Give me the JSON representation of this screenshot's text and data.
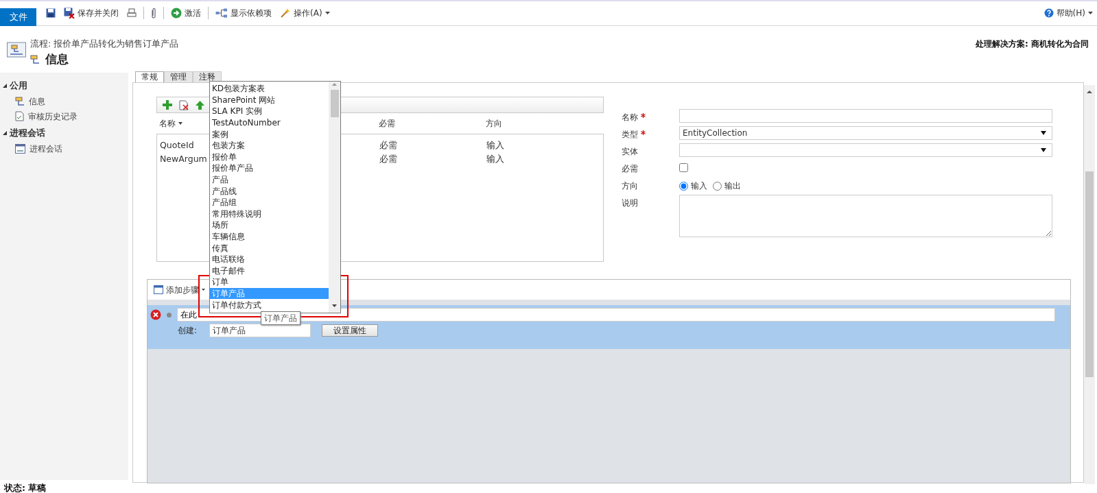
{
  "toolbar": {
    "file_tab": "文件",
    "items": [
      {
        "kind": "save"
      },
      {
        "kind": "save_close",
        "label": "保存并关闭"
      },
      {
        "kind": "print"
      },
      {
        "kind": "separator"
      },
      {
        "kind": "attach"
      },
      {
        "kind": "separator"
      },
      {
        "kind": "activate",
        "label": "激活"
      },
      {
        "kind": "separator"
      },
      {
        "kind": "dependencies",
        "label": "显示依赖项"
      },
      {
        "kind": "actions",
        "label": "操作(A)",
        "menu": true
      }
    ],
    "help": {
      "label": "帮助(H)",
      "menu": true
    }
  },
  "header": {
    "breadcrumb": "流程: 报价单产品转化为销售订单产品",
    "title": "信息",
    "solution": "处理解决方案: 商机转化为合同"
  },
  "sidebar": {
    "groups": [
      {
        "label": "公用",
        "expanded": true,
        "items": [
          {
            "label": "信息",
            "kind": "process"
          },
          {
            "label": "审核历史记录",
            "kind": "audit"
          }
        ]
      },
      {
        "label": "进程会话",
        "expanded": true,
        "items": [
          {
            "label": "进程会话",
            "kind": "session"
          }
        ]
      }
    ]
  },
  "tabs": [
    {
      "label": "常规",
      "selected": true
    },
    {
      "label": "管理",
      "selected": false
    },
    {
      "label": "注释",
      "selected": false
    }
  ],
  "arguments": {
    "columns": [
      "名称",
      "必需",
      "方向"
    ],
    "rows": [
      {
        "name": "QuoteId",
        "required": "必需",
        "direction": "输入"
      },
      {
        "name": "NewArgum",
        "required": "必需",
        "direction": "输入"
      }
    ]
  },
  "form": {
    "fields": [
      {
        "kind": "text",
        "label": "名称",
        "required": true
      },
      {
        "kind": "select",
        "label": "类型",
        "required": true,
        "value": "EntityCollection"
      },
      {
        "kind": "select",
        "label": "实体"
      },
      {
        "kind": "checkbox",
        "label": "必需",
        "checked": false
      },
      {
        "kind": "radio",
        "label": "方向",
        "options": [
          {
            "label": "输入",
            "selected": true
          },
          {
            "label": "输出",
            "selected": false
          }
        ]
      },
      {
        "kind": "textarea",
        "label": "说明"
      }
    ]
  },
  "steps": {
    "add_step": "添加步骤",
    "step": {
      "text": "在此",
      "create_label": "创建:",
      "entity": "订单产品",
      "button": "设置属性"
    }
  },
  "dropdown": {
    "items": [
      {
        "label": "KD包装方案表",
        "selected": false
      },
      {
        "label": "SharePoint 网站",
        "selected": false
      },
      {
        "label": "SLA KPI 实例",
        "selected": false
      },
      {
        "label": "TestAutoNumber",
        "selected": false
      },
      {
        "label": "案例",
        "selected": false
      },
      {
        "label": "包装方案",
        "selected": false
      },
      {
        "label": "报价单",
        "selected": false
      },
      {
        "label": "报价单产品",
        "selected": false
      },
      {
        "label": "产品",
        "selected": false
      },
      {
        "label": "产品线",
        "selected": false
      },
      {
        "label": "产品组",
        "selected": false
      },
      {
        "label": "常用特殊说明",
        "selected": false
      },
      {
        "label": "场所",
        "selected": false
      },
      {
        "label": "车辆信息",
        "selected": false
      },
      {
        "label": "传真",
        "selected": false
      },
      {
        "label": "电话联络",
        "selected": false
      },
      {
        "label": "电子邮件",
        "selected": false
      },
      {
        "label": "订单",
        "selected": false
      },
      {
        "label": "订单产品",
        "selected": true
      },
      {
        "label": "订单付款方式",
        "selected": false
      }
    ],
    "tooltip": "订单产品"
  },
  "status_bar": "状态: 草稿"
}
